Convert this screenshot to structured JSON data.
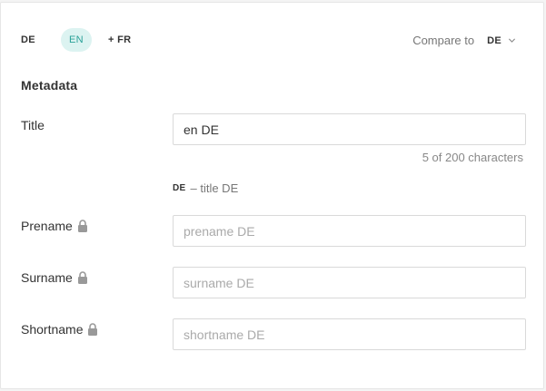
{
  "languages": {
    "tabs": [
      {
        "label": "DE",
        "active": false
      },
      {
        "label": "EN",
        "active": true
      }
    ],
    "add_label": "+ FR"
  },
  "compare": {
    "label": "Compare to",
    "value": "DE",
    "icon": "chevron-down-icon"
  },
  "section": {
    "title": "Metadata"
  },
  "fields": {
    "title": {
      "label": "Title",
      "value": "en DE",
      "char_count": "5 of 200 characters",
      "compare_lang": "DE",
      "compare_text": "– title DE"
    },
    "prename": {
      "label": "Prename",
      "placeholder": "prename DE",
      "icon": "lock-icon"
    },
    "surname": {
      "label": "Surname",
      "placeholder": "surname DE",
      "icon": "lock-icon"
    },
    "shortname": {
      "label": "Shortname",
      "placeholder": "shortname DE",
      "icon": "lock-icon"
    }
  },
  "colors": {
    "accent": "#2aa198",
    "accent_bg": "#dcf3f1",
    "lock": "#999999"
  }
}
